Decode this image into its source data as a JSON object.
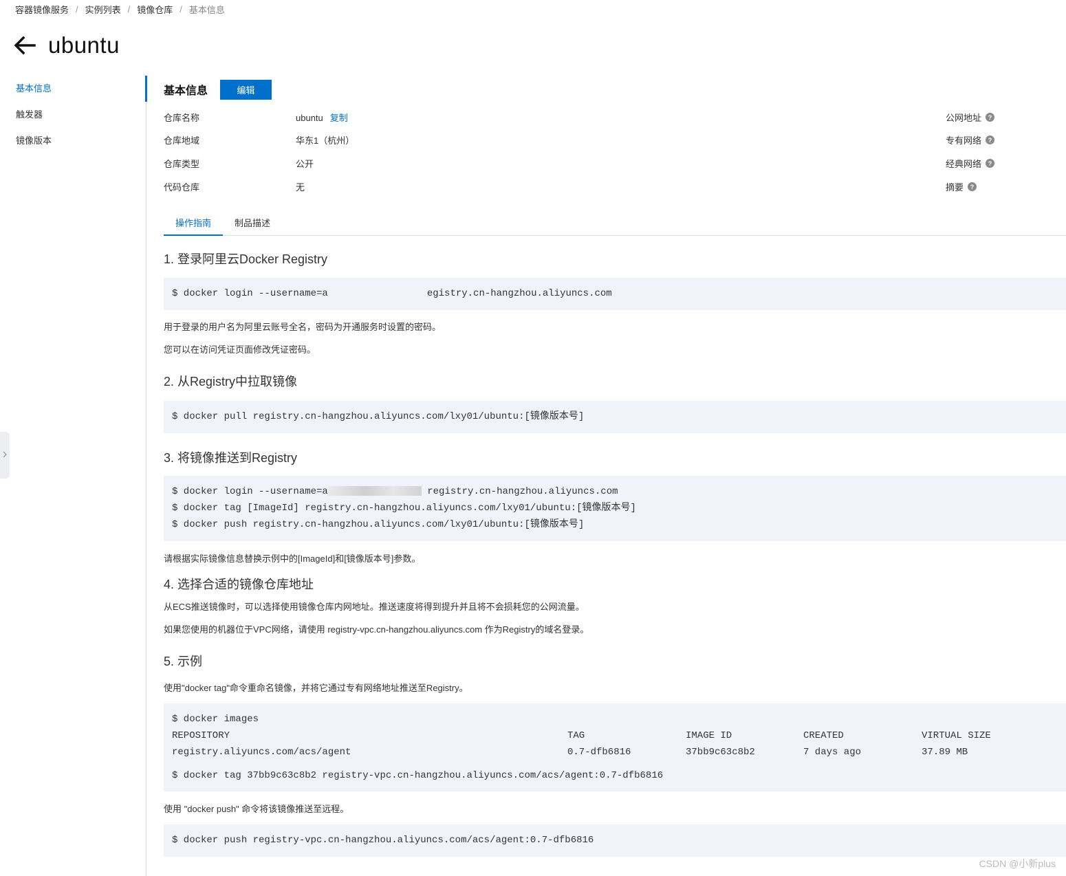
{
  "breadcrumb": [
    "容器镜像服务",
    "实例列表",
    "镜像仓库",
    "基本信息"
  ],
  "title": "ubuntu",
  "sidebar": {
    "items": [
      "基本信息",
      "触发器",
      "镜像版本"
    ]
  },
  "basic_info": {
    "title": "基本信息",
    "edit_label": "编辑",
    "fields": [
      {
        "label": "仓库名称",
        "value": "ubuntu"
      },
      {
        "label": "仓库地域",
        "value": "华东1（杭州）"
      },
      {
        "label": "仓库类型",
        "value": "公开"
      },
      {
        "label": "代码仓库",
        "value": "无"
      }
    ],
    "copy_label": "复制",
    "right_labels": [
      "公网地址",
      "专有网络",
      "经典网络",
      "摘要"
    ]
  },
  "tabs": [
    "操作指南",
    "制品描述"
  ],
  "guide": {
    "s1_title": "1. 登录阿里云Docker Registry",
    "s1_code_a": "$ docker login --username=a",
    "s1_code_b": "egistry.cn-hangzhou.aliyuncs.com",
    "s1_p1": "用于登录的用户名为阿里云账号全名，密码为开通服务时设置的密码。",
    "s1_p2": "您可以在访问凭证页面修改凭证密码。",
    "s2_title": "2. 从Registry中拉取镜像",
    "s2_code": "$ docker pull registry.cn-hangzhou.aliyuncs.com/lxy01/ubuntu:[镜像版本号]",
    "s3_title": "3. 将镜像推送到Registry",
    "s3_code_1a": "$ docker login --username=a",
    "s3_code_1b": "registry.cn-hangzhou.aliyuncs.com",
    "s3_code_2": "$ docker tag [ImageId] registry.cn-hangzhou.aliyuncs.com/lxy01/ubuntu:[镜像版本号]",
    "s3_code_3": "$ docker push registry.cn-hangzhou.aliyuncs.com/lxy01/ubuntu:[镜像版本号]",
    "s3_p": "请根据实际镜像信息替换示例中的[ImageId]和[镜像版本号]参数。",
    "s4_title": "4. 选择合适的镜像仓库地址",
    "s4_p1": "从ECS推送镜像时，可以选择使用镜像仓库内网地址。推送速度将得到提升并且将不会损耗您的公网流量。",
    "s4_p2": "如果您使用的机器位于VPC网络，请使用 registry-vpc.cn-hangzhou.aliyuncs.com 作为Registry的域名登录。",
    "s5_title": "5. 示例",
    "s5_p1": "使用\"docker tag\"命令重命名镜像，并将它通过专有网络地址推送至Registry。",
    "s5_code_images": "$ docker images",
    "s5_headers": [
      "REPOSITORY",
      "TAG",
      "IMAGE ID",
      "CREATED",
      "VIRTUAL SIZE"
    ],
    "s5_row": [
      "registry.aliyuncs.com/acs/agent",
      "0.7-dfb6816",
      "37bb9c63c8b2",
      "7 days ago",
      "37.89 MB"
    ],
    "s5_code_tag": "$ docker tag 37bb9c63c8b2 registry-vpc.cn-hangzhou.aliyuncs.com/acs/agent:0.7-dfb6816",
    "s5_p2": "使用 \"docker push\" 命令将该镜像推送至远程。",
    "s5_code_push": "$ docker push registry-vpc.cn-hangzhou.aliyuncs.com/acs/agent:0.7-dfb6816"
  },
  "watermark": "CSDN @小新plus",
  "colors": {
    "accent": "#0070cc",
    "code_bg": "#f0f4fa"
  }
}
